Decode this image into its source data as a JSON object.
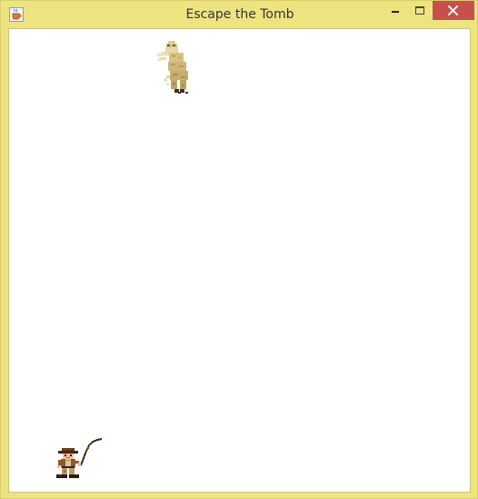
{
  "window": {
    "title": "Escape the Tomb",
    "app_icon": "java-coffee-cup-icon",
    "controls": {
      "minimize_icon": "minimize-icon",
      "maximize_icon": "maximize-icon",
      "close_icon": "close-icon"
    },
    "colors": {
      "frame": "#ede47f",
      "close_button": "#c7504c",
      "canvas": "#ffffff"
    }
  },
  "game": {
    "sprites": [
      {
        "kind": "mummy",
        "icon": "mummy-enemy-icon"
      },
      {
        "kind": "explorer",
        "icon": "explorer-player-icon"
      }
    ]
  }
}
